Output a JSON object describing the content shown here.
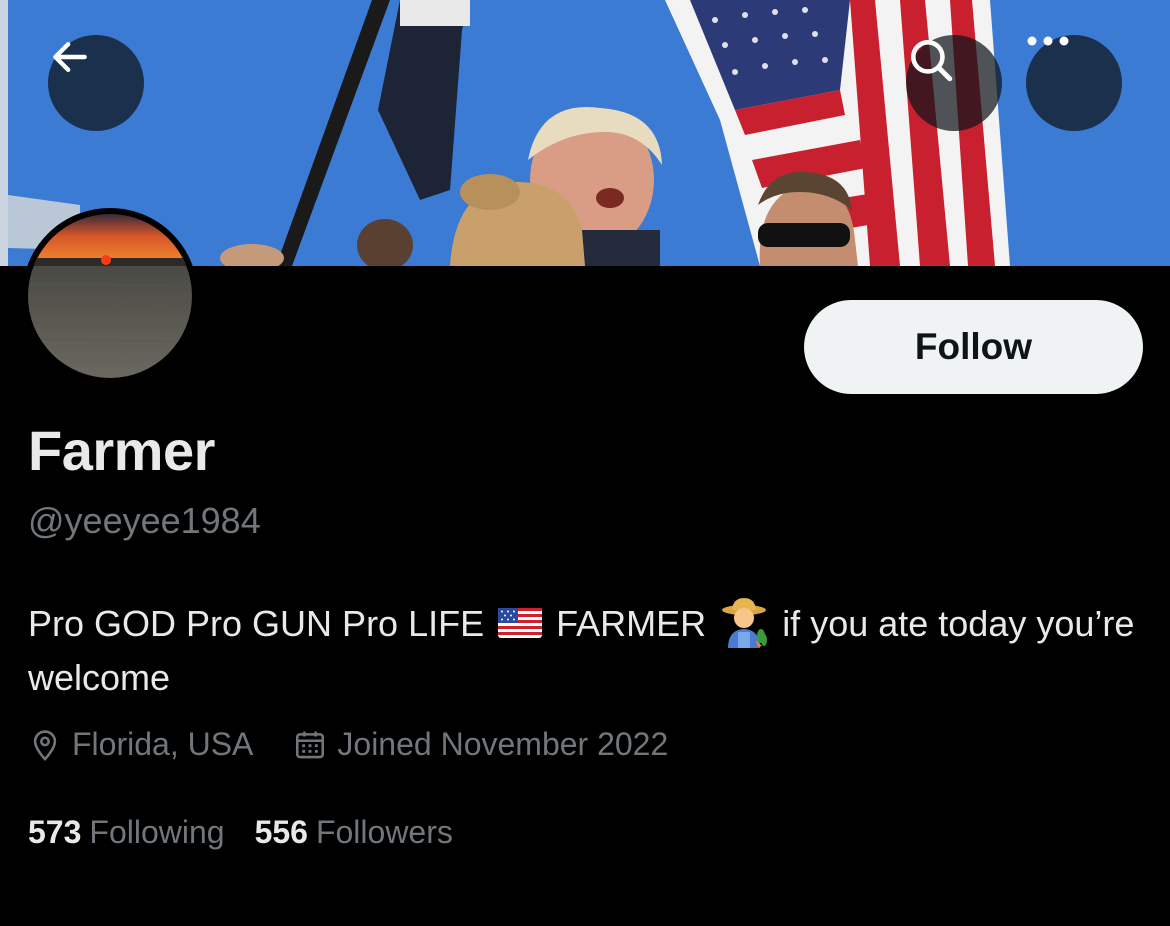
{
  "header": {
    "back_icon": "arrow-left-icon",
    "search_icon": "search-icon",
    "more_icon": "more-horizontal-icon"
  },
  "profile": {
    "display_name": "Farmer",
    "handle": "@yeeyee1984",
    "bio_part1": "Pro GOD Pro GUN Pro LIFE",
    "bio_emoji1": "us-flag-emoji",
    "bio_part2": "FARMER",
    "bio_emoji2": "farmer-emoji",
    "bio_part3": "if you ate today you’re welcome",
    "location": "Florida, USA",
    "location_icon": "location-pin-icon",
    "joined": "Joined November 2022",
    "joined_icon": "calendar-icon"
  },
  "actions": {
    "follow_label": "Follow"
  },
  "stats": {
    "following_count": "573",
    "following_label": "Following",
    "followers_count": "556",
    "followers_label": "Followers"
  },
  "colors": {
    "background": "#000000",
    "primary_text": "#e7e9ea",
    "secondary_text": "#71767b",
    "follow_button_bg": "#eff3f4",
    "follow_button_text": "#0f1419"
  }
}
